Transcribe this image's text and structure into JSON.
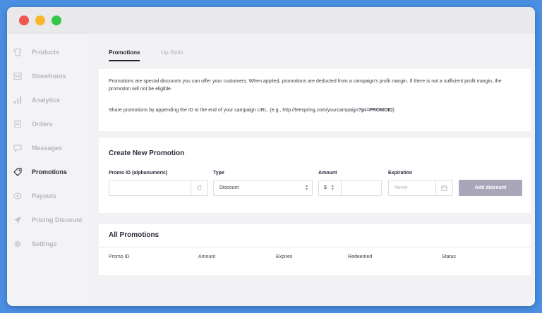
{
  "sidebar": {
    "items": [
      {
        "label": "Products",
        "icon": "shirt-icon"
      },
      {
        "label": "Storefronts",
        "icon": "storefront-icon"
      },
      {
        "label": "Analytics",
        "icon": "bar-chart-icon"
      },
      {
        "label": "Orders",
        "icon": "orders-icon"
      },
      {
        "label": "Messages",
        "icon": "message-icon"
      },
      {
        "label": "Promotions",
        "icon": "tag-icon"
      },
      {
        "label": "Payouts",
        "icon": "payout-icon"
      },
      {
        "label": "Pricing Discount",
        "icon": "rocket-icon"
      },
      {
        "label": "Settings",
        "icon": "gear-icon"
      }
    ],
    "active": "Promotions"
  },
  "tabs": [
    {
      "label": "Promotions",
      "active": true
    },
    {
      "label": "Up-Sells",
      "active": false
    }
  ],
  "info": {
    "line1": "Promotions are special discounts you can offer your customers. When applied, promotions are deducted from a campaign's profit margin. If there is not a sufficient profit margin, the promotion will not be eligible.",
    "line2_prefix": "Share promotions by appending the ID to the end of your campaign URL. (e.g., http://teespring.com/yourcampaign",
    "line2_bold": "?pr=PROMOID",
    "line2_suffix": ")"
  },
  "create": {
    "title": "Create New Promotion",
    "promo_label": "Promo ID (alphanumeric)",
    "type_label": "Type",
    "type_value": "Discount",
    "amount_label": "Amount",
    "amount_currency": "$",
    "expiration_label": "Expiration",
    "expiration_placeholder": "Never",
    "add_button": "Add discount"
  },
  "all": {
    "title": "All Promotions",
    "columns": [
      "Promo ID",
      "Amount",
      "Expires",
      "Redeemed",
      "Status"
    ]
  },
  "colors": {
    "background": "#4a8fe2",
    "accent_button": "#a9a6ba",
    "dot_red": "#f0564e",
    "dot_yellow": "#f6b52a",
    "dot_green": "#36c549"
  }
}
